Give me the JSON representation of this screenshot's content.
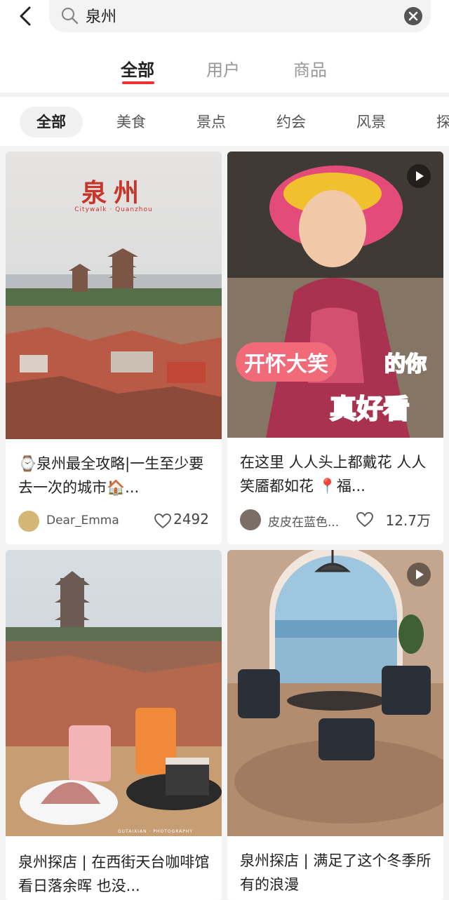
{
  "search": {
    "query": "泉州"
  },
  "main_tabs": [
    {
      "label": "全部",
      "active": true
    },
    {
      "label": "用户",
      "active": false
    },
    {
      "label": "商品",
      "active": false
    }
  ],
  "filter_chips": [
    {
      "label": "全部",
      "active": true
    },
    {
      "label": "美食"
    },
    {
      "label": "景点"
    },
    {
      "label": "约会"
    },
    {
      "label": "风景"
    },
    {
      "label": "探"
    }
  ],
  "cards": [
    {
      "image_text": {
        "title": "泉州",
        "subtitle": "Citywalk · Quanzhou"
      },
      "title": "⌚泉州最全攻略|一生至少要去一次的城市🏠...",
      "author": "Dear_Emma",
      "likes": "2492",
      "is_video": false
    },
    {
      "image_text": {
        "line1": "开怀大笑",
        "line1b": "的你",
        "line2": "真好看"
      },
      "title": "在这里 人人头上都戴花 人人笑靥都如花 📍福...",
      "author": "皮皮在蓝色...",
      "likes": "12.7万",
      "is_video": true
    },
    {
      "image_text": {
        "watermark": "GUTAIXIAN · PHOTOGRAPHY"
      },
      "title": "泉州探店 | 在西街天台咖啡馆看日落余晖 也没...",
      "is_video": false
    },
    {
      "title": "泉州探店 | 满足了这个冬季所有的浪漫",
      "is_video": true
    }
  ],
  "colors": {
    "accent": "#e33333",
    "bg": "#f4f4f4"
  }
}
